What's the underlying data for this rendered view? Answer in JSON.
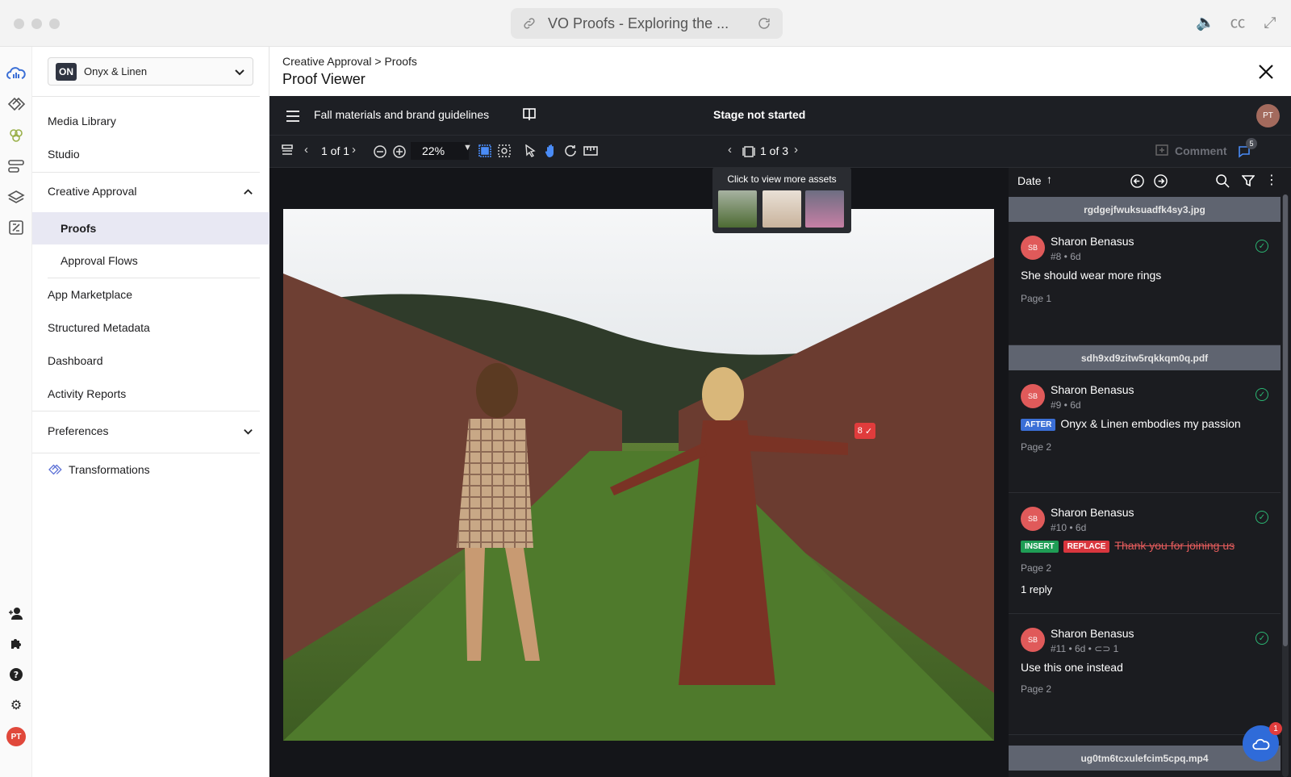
{
  "window": {
    "tab_title": "VO Proofs - Exploring the ..."
  },
  "sidebar": {
    "org_badge": "ON",
    "org_name": "Onyx & Linen",
    "items": [
      {
        "label": "Media Library"
      },
      {
        "label": "Studio"
      },
      {
        "label": "Creative Approval"
      },
      {
        "label": "Proofs"
      },
      {
        "label": "Approval Flows"
      },
      {
        "label": "App Marketplace"
      },
      {
        "label": "Structured Metadata"
      },
      {
        "label": "Dashboard"
      },
      {
        "label": "Activity Reports"
      },
      {
        "label": "Preferences"
      },
      {
        "label": "Transformations"
      }
    ],
    "user_initials": "PT"
  },
  "header": {
    "breadcrumb": "Creative Approval > Proofs",
    "title": "Proof Viewer"
  },
  "viewer": {
    "proof_name": "Fall materials and brand guidelines",
    "stage": "Stage not started",
    "user_initials": "PT",
    "page_counter": "1 of 1",
    "zoom": "22%",
    "asset_counter": "1 of 3",
    "tooltip": "Click to view more assets",
    "comment_label": "Comment",
    "comment_badge": "5",
    "marker_number": "8",
    "colors": {
      "accent": "#4a8cf7",
      "dark_bg": "#141519",
      "resolved": "#2bb673"
    }
  },
  "comments_panel": {
    "sort_label": "Date",
    "groups": [
      {
        "file": "rgdgejfwuksuadfk4sy3.jpg"
      },
      {
        "file": "sdh9xd9zitw5rqkkqm0q.pdf"
      },
      {
        "file": "ug0tm6tcxulefcim5cpq.mp4"
      }
    ],
    "comments": [
      {
        "initials": "SB",
        "author": "Sharon Benasus",
        "meta": "#8 • 6d",
        "text": "She should wear more rings",
        "page": "Page 1"
      },
      {
        "initials": "SB",
        "author": "Sharon Benasus",
        "meta": "#9 • 6d",
        "tag": "AFTER",
        "text": "Onyx & Linen embodies my passion",
        "page": "Page 2"
      },
      {
        "initials": "SB",
        "author": "Sharon Benasus",
        "meta": "#10 • 6d",
        "tag_insert": "INSERT",
        "tag_replace": "REPLACE",
        "struck_text": "Thank  you for joining us",
        "page": "Page 2",
        "reply": "1 reply"
      },
      {
        "initials": "SB",
        "author": "Sharon Benasus",
        "meta": "#11 • 6d • ",
        "meta_count": "1",
        "text": "Use this one instead",
        "page": "Page 2"
      }
    ]
  },
  "fab_badge": "1"
}
